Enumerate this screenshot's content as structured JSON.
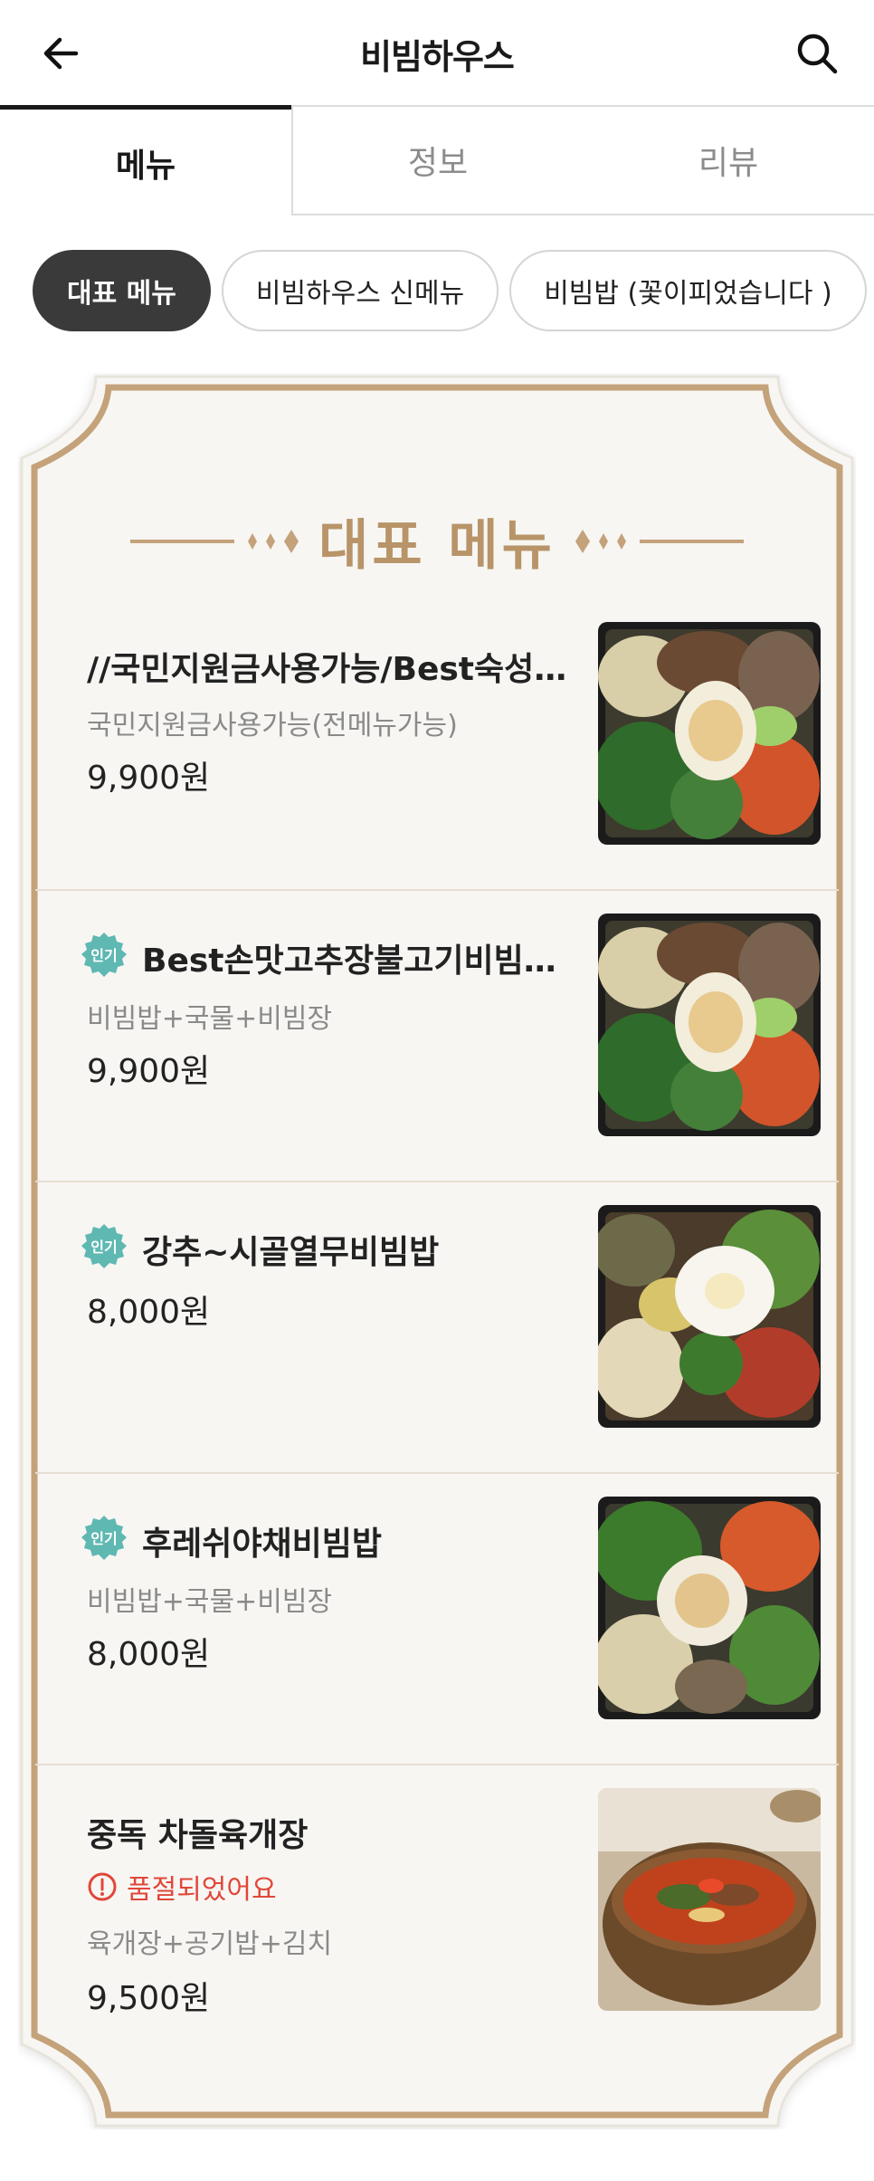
{
  "header": {
    "title": "비빔하우스",
    "back_icon": "arrow-left-icon",
    "search_icon": "search-icon"
  },
  "tabs": [
    {
      "label": "메뉴",
      "active": true
    },
    {
      "label": "정보",
      "active": false
    },
    {
      "label": "리뷰",
      "active": false
    }
  ],
  "chips": [
    {
      "label": "대표 메뉴",
      "active": true
    },
    {
      "label": "비빔하우스 신메뉴",
      "active": false
    },
    {
      "label": "비빔밥 (꽃이피었습니다 )",
      "active": false
    }
  ],
  "section": {
    "title": "대표 메뉴"
  },
  "badge_label": "인기",
  "menu_items": [
    {
      "name": "//국민지원금사용가능/Best숙성…",
      "description": "국민지원금사용가능(전메뉴가능)",
      "price": "9,900원",
      "popular": false,
      "sold_out": false
    },
    {
      "name": "Best손맛고추장불고기비빔…",
      "description": "비빔밥+국물+비빔장",
      "price": "9,900원",
      "popular": true,
      "sold_out": false
    },
    {
      "name": "강추~시골열무비빔밥",
      "description": "",
      "price": "8,000원",
      "popular": true,
      "sold_out": false
    },
    {
      "name": "후레쉬야채비빔밥",
      "description": "비빔밥+국물+비빔장",
      "price": "8,000원",
      "popular": true,
      "sold_out": false
    },
    {
      "name": "중독 차돌육개장",
      "sold_out_text": "품절되었어요",
      "description": "육개장+공기밥+김치",
      "price": "9,500원",
      "popular": false,
      "sold_out": true
    }
  ],
  "colors": {
    "gold": "#c4a27a",
    "badge_teal": "#5fb8b2",
    "soldout_red": "#e0473a",
    "chip_active": "#3a3a3a"
  }
}
